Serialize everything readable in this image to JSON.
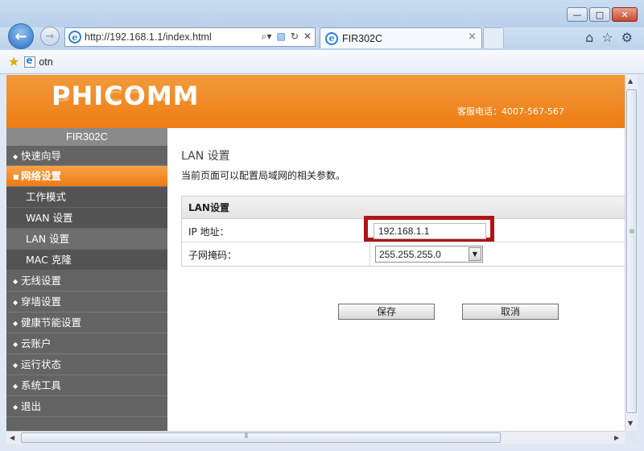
{
  "browser": {
    "url": "http://192.168.1.1/index.html",
    "tab_title": "FIR302C",
    "tab_close": "×",
    "favorites": [
      {
        "label": "otn"
      }
    ],
    "window_buttons": {
      "minimize": "—",
      "maximize": "□",
      "close": "✕"
    },
    "icons": [
      "back-arrow-icon",
      "forward-arrow-icon",
      "ie-icon",
      "search-icon",
      "compat-view-icon",
      "refresh-icon",
      "stop-icon",
      "home-icon",
      "favorites-star-icon",
      "gear-icon"
    ]
  },
  "router": {
    "brand": "PHICOMM",
    "hotline": "客服电话：4007-567-567",
    "model": "FIR302C",
    "accent_color": "#ef8220"
  },
  "sidebar": {
    "items": [
      {
        "label": "快速向导"
      },
      {
        "label": "网络设置",
        "active": true
      },
      {
        "label": "工作模式"
      },
      {
        "label": "WAN 设置"
      },
      {
        "label": "LAN 设置",
        "current": true
      },
      {
        "label": "MAC 克隆"
      },
      {
        "label": "无线设置"
      },
      {
        "label": "穿墙设置"
      },
      {
        "label": "健康节能设置"
      },
      {
        "label": "云账户"
      },
      {
        "label": "运行状态"
      },
      {
        "label": "系统工具"
      },
      {
        "label": "退出"
      }
    ]
  },
  "main": {
    "title": "LAN 设置",
    "description": "当前页面可以配置局域网的相关参数。",
    "panel": {
      "heading": "LAN设置",
      "ip_label": "IP 地址：",
      "ip_value": "192.168.1.1",
      "mask_label": "子网掩码：",
      "mask_value": "255.255.255.0"
    },
    "save_label": "保存",
    "cancel_label": "取消"
  }
}
